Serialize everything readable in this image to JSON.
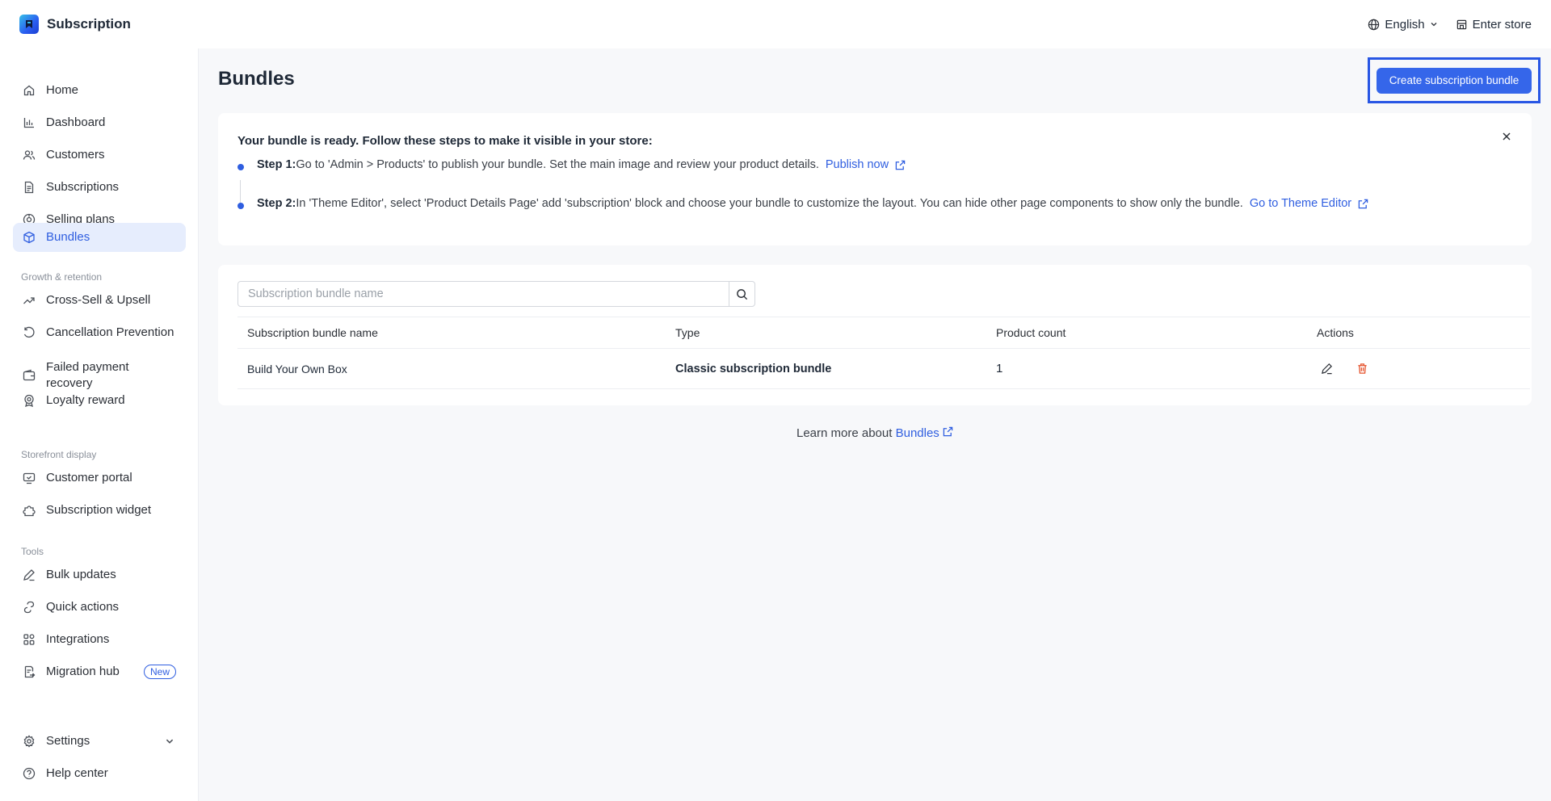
{
  "app": {
    "title": "Subscription"
  },
  "topbar": {
    "language": "English",
    "enter_store": "Enter store"
  },
  "sidebar": {
    "items": [
      {
        "label": "Home",
        "icon": "home-icon"
      },
      {
        "label": "Dashboard",
        "icon": "bar-chart-icon"
      },
      {
        "label": "Customers",
        "icon": "users-icon"
      },
      {
        "label": "Subscriptions",
        "icon": "document-icon"
      },
      {
        "label": "Selling plans",
        "icon": "tag-icon"
      },
      {
        "label": "Bundles",
        "icon": "box-icon",
        "active": true
      }
    ],
    "sections": {
      "growth": "Growth & retention",
      "storefront": "Storefront display",
      "tools": "Tools"
    },
    "growth_items": [
      {
        "label": "Cross-Sell & Upsell",
        "icon": "trend-up-icon"
      },
      {
        "label": "Cancellation Prevention",
        "icon": "rotate-icon"
      },
      {
        "label": "Failed payment recovery",
        "icon": "wallet-icon"
      },
      {
        "label": "Loyalty reward",
        "icon": "medal-icon"
      }
    ],
    "storefront_items": [
      {
        "label": "Customer portal",
        "icon": "portal-icon"
      },
      {
        "label": "Subscription widget",
        "icon": "puzzle-icon"
      }
    ],
    "tools_items": [
      {
        "label": "Bulk updates",
        "icon": "edit-icon"
      },
      {
        "label": "Quick actions",
        "icon": "lightning-icon"
      },
      {
        "label": "Integrations",
        "icon": "grid-icon"
      },
      {
        "label": "Migration hub",
        "icon": "migrate-icon",
        "badge": "New"
      }
    ],
    "bottom_items": [
      {
        "label": "Settings",
        "icon": "gear-icon"
      },
      {
        "label": "Help center",
        "icon": "help-icon"
      }
    ]
  },
  "main": {
    "title": "Bundles",
    "create_button": "Create subscription bundle",
    "info": {
      "heading": "Your bundle is ready. Follow these steps to make it visible in your store:",
      "step1_label": "Step 1:",
      "step1_text": "Go to 'Admin > Products' to publish your bundle. Set the main image and review your product details.",
      "step1_link": "Publish now",
      "step2_label": "Step 2:",
      "step2_text": "In 'Theme Editor', select 'Product Details Page' add 'subscription' block and choose your bundle to customize the layout. You can hide other page components to show only the bundle.",
      "step2_link": "Go to Theme Editor"
    },
    "search": {
      "placeholder": "Subscription bundle name"
    },
    "table": {
      "columns": [
        "Subscription bundle name",
        "Type",
        "Product count",
        "Actions"
      ],
      "rows": [
        {
          "name": "Build Your Own Box",
          "type": "Classic subscription bundle",
          "count": "1"
        }
      ]
    },
    "learn_more": {
      "text": "Learn more about",
      "link": "Bundles"
    }
  },
  "colors": {
    "accent": "#3566ea",
    "active_bg": "#e6edfd",
    "delete": "#e5532d"
  }
}
